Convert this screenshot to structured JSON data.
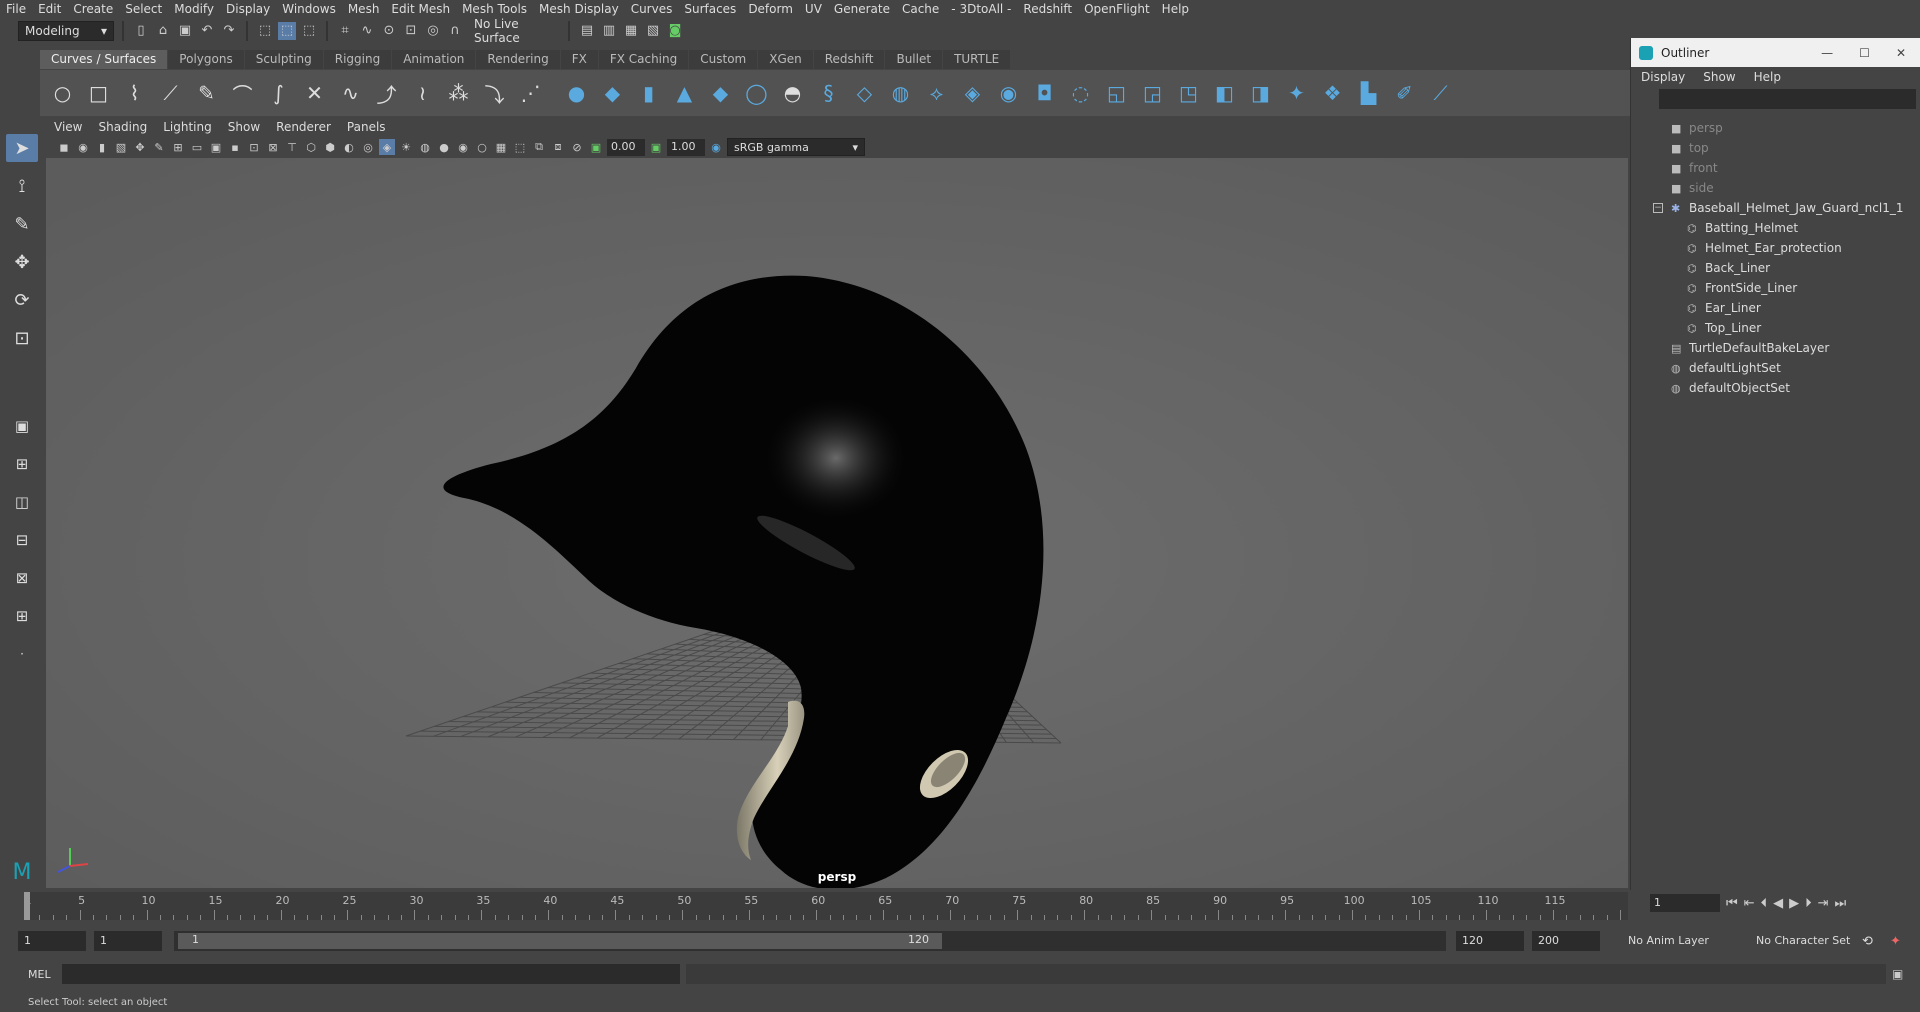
{
  "menubar": [
    "File",
    "Edit",
    "Create",
    "Select",
    "Modify",
    "Display",
    "Windows",
    "Mesh",
    "Edit Mesh",
    "Mesh Tools",
    "Mesh Display",
    "Curves",
    "Surfaces",
    "Deform",
    "UV",
    "Generate",
    "Cache",
    "- 3DtoAll -",
    "Redshift",
    "OpenFlight",
    "Help"
  ],
  "status": {
    "mode": "Modeling",
    "live_surface": "No Live Surface"
  },
  "shelf_tabs": [
    "Curves / Surfaces",
    "Polygons",
    "Sculpting",
    "Rigging",
    "Animation",
    "Rendering",
    "FX",
    "FX Caching",
    "Custom",
    "XGen",
    "Redshift",
    "Bullet",
    "TURTLE"
  ],
  "viewport": {
    "menu": [
      "View",
      "Shading",
      "Lighting",
      "Show",
      "Renderer",
      "Panels"
    ],
    "exposure": "0.00",
    "gamma": "1.00",
    "color_space": "sRGB gamma",
    "camera_label": "persp"
  },
  "outliner": {
    "title": "Outliner",
    "menu": [
      "Display",
      "Show",
      "Help"
    ],
    "items": [
      {
        "label": "persp",
        "indent": 1,
        "dim": true,
        "icon": "camera-icon"
      },
      {
        "label": "top",
        "indent": 1,
        "dim": true,
        "icon": "camera-icon"
      },
      {
        "label": "front",
        "indent": 1,
        "dim": true,
        "icon": "camera-icon"
      },
      {
        "label": "side",
        "indent": 1,
        "dim": true,
        "icon": "camera-icon"
      },
      {
        "label": "Baseball_Helmet_Jaw_Guard_ncl1_1",
        "indent": 1,
        "dim": false,
        "icon": "group-icon"
      },
      {
        "label": "Batting_Helmet",
        "indent": 2,
        "dim": false,
        "icon": "mesh-icon"
      },
      {
        "label": "Helmet_Ear_protection",
        "indent": 2,
        "dim": false,
        "icon": "mesh-icon"
      },
      {
        "label": "Back_Liner",
        "indent": 2,
        "dim": false,
        "icon": "mesh-icon"
      },
      {
        "label": "FrontSide_Liner",
        "indent": 2,
        "dim": false,
        "icon": "mesh-icon"
      },
      {
        "label": "Ear_Liner",
        "indent": 2,
        "dim": false,
        "icon": "mesh-icon"
      },
      {
        "label": "Top_Liner",
        "indent": 2,
        "dim": false,
        "icon": "mesh-icon"
      },
      {
        "label": "TurtleDefaultBakeLayer",
        "indent": 1,
        "dim": false,
        "icon": "layer-icon"
      },
      {
        "label": "defaultLightSet",
        "indent": 1,
        "dim": false,
        "icon": "set-icon"
      },
      {
        "label": "defaultObjectSet",
        "indent": 1,
        "dim": false,
        "icon": "set-icon"
      }
    ]
  },
  "timeline": {
    "ticks": [
      "1",
      "5",
      "10",
      "15",
      "20",
      "25",
      "30",
      "35",
      "40",
      "45",
      "50",
      "55",
      "60",
      "65",
      "70",
      "75",
      "80",
      "85",
      "90",
      "95",
      "100",
      "105",
      "110",
      "115"
    ],
    "current_frame": "1"
  },
  "range": {
    "start": "1",
    "playback_start": "1",
    "bar_start": "1",
    "bar_end": "120",
    "playback_end": "120",
    "end": "200",
    "anim_layer": "No Anim Layer",
    "character_set": "No Character Set"
  },
  "cmdline": {
    "label": "MEL"
  },
  "help_line": "Select Tool: select an object"
}
